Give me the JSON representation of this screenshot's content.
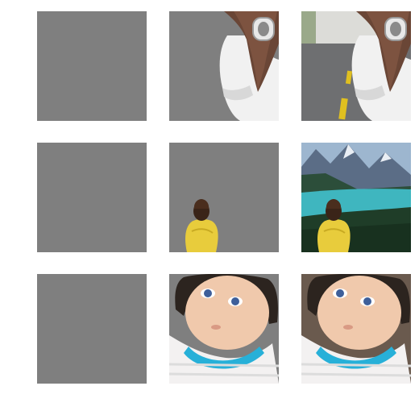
{
  "grid": {
    "rows": [
      {
        "placeholder": {
          "icon": "gray-square"
        },
        "cutout": {
          "icon": "woman-with-mug-cutout"
        },
        "composite": {
          "icon": "woman-on-road-photo"
        }
      },
      {
        "placeholder": {
          "icon": "gray-square"
        },
        "cutout": {
          "icon": "child-yellow-shirt-cutout"
        },
        "composite": {
          "icon": "child-at-mountain-lake-photo"
        }
      },
      {
        "placeholder": {
          "icon": "gray-square"
        },
        "cutout": {
          "icon": "baby-face-cutout"
        },
        "composite": {
          "icon": "baby-face-photo"
        }
      }
    ],
    "colors": {
      "placeholder_gray": "#7f7f7f",
      "background": "#ffffff",
      "road": "#6e6f71",
      "lane_marking": "#e0c020",
      "lake": "#3fb6bf",
      "forest": "#1f3d28",
      "shirt_yellow": "#e8cc3c",
      "bib_cyan": "#27b0d8"
    }
  }
}
